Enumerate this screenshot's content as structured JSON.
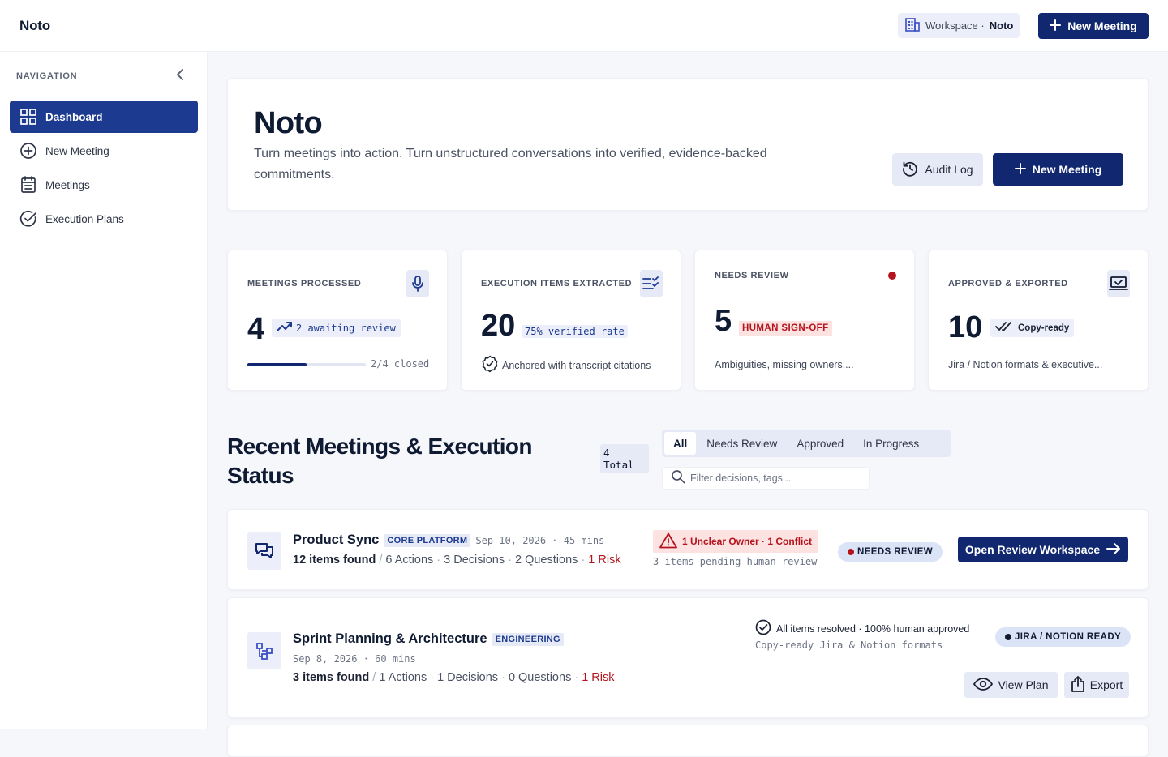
{
  "app": {
    "brand": "Noto"
  },
  "topbar": {
    "workspace_label": "Workspace ·",
    "workspace_name": "Noto",
    "new_meeting": "New Meeting"
  },
  "sidebar": {
    "heading": "NAVIGATION",
    "items": [
      {
        "label": "Dashboard",
        "icon": "grid-icon",
        "active": true
      },
      {
        "label": "New Meeting",
        "icon": "plus-circle-icon"
      },
      {
        "label": "Meetings",
        "icon": "calendar-list-icon"
      },
      {
        "label": "Execution Plans",
        "icon": "check-circle-icon"
      }
    ]
  },
  "hero": {
    "title": "Noto",
    "subtitle": "Turn meetings into action. Turn unstructured conversations into verified, evidence-backed commitments.",
    "audit_log": "Audit Log",
    "new_meeting": "New Meeting"
  },
  "stats": [
    {
      "label": "MEETINGS PROCESSED",
      "value": "4",
      "chip": "2 awaiting review",
      "progress_text": "2/4 closed",
      "progress": 0.5,
      "icon": "microphone-icon"
    },
    {
      "label": "EXECUTION ITEMS EXTRACTED",
      "value": "20",
      "chip": "75% verified rate",
      "foot": "Anchored with transcript citations",
      "icon": "checklist-icon"
    },
    {
      "label": "NEEDS REVIEW",
      "value": "5",
      "chip": "HUMAN SIGN-OFF",
      "foot": "Ambiguities, missing owners,...",
      "status_color": "#b4151d"
    },
    {
      "label": "APPROVED & EXPORTED",
      "value": "10",
      "chip": "Copy-ready",
      "foot": "Jira / Notion formats & executive...",
      "icon": "laptop-check-icon"
    }
  ],
  "section": {
    "title": "Recent Meetings & Execution Status",
    "total": "4 Total",
    "tabs": [
      "All",
      "Needs Review",
      "Approved",
      "In Progress"
    ],
    "active_tab": "All",
    "filter_placeholder": "Filter decisions, tags..."
  },
  "meetings": [
    {
      "title": "Product Sync",
      "tag": "CORE PLATFORM",
      "meta": "Sep 10, 2026 · 45 mins",
      "found": "12 items found",
      "actions": "6 Actions",
      "decisions": "3 Decisions",
      "questions": "2 Questions",
      "risk": "1 Risk",
      "alert": "1 Unclear Owner · 1 Conflict",
      "pending": "3 items pending human review",
      "status": "NEEDS REVIEW",
      "status_color": "#b4151d",
      "action_label": "Open Review Workspace",
      "icon": "chat-bubbles-icon"
    },
    {
      "title": "Sprint Planning & Architecture",
      "tag": "ENGINEERING",
      "meta": "Sep 8, 2026 · 60 mins",
      "found": "3 items found",
      "actions": "1 Actions",
      "decisions": "1 Decisions",
      "questions": "0 Questions",
      "risk": "1 Risk",
      "resolved": "All items resolved · 100% human approved",
      "formats": "Copy-ready Jira & Notion formats",
      "status": "JIRA / NOTION READY",
      "status_color": "#0f1a33",
      "view_label": "View Plan",
      "export_label": "Export",
      "icon": "hierarchy-icon"
    }
  ],
  "colors": {
    "primary": "#112870",
    "active_nav": "#1c3a8f",
    "danger": "#b4151d",
    "chip_bg": "#e6eaf7"
  }
}
